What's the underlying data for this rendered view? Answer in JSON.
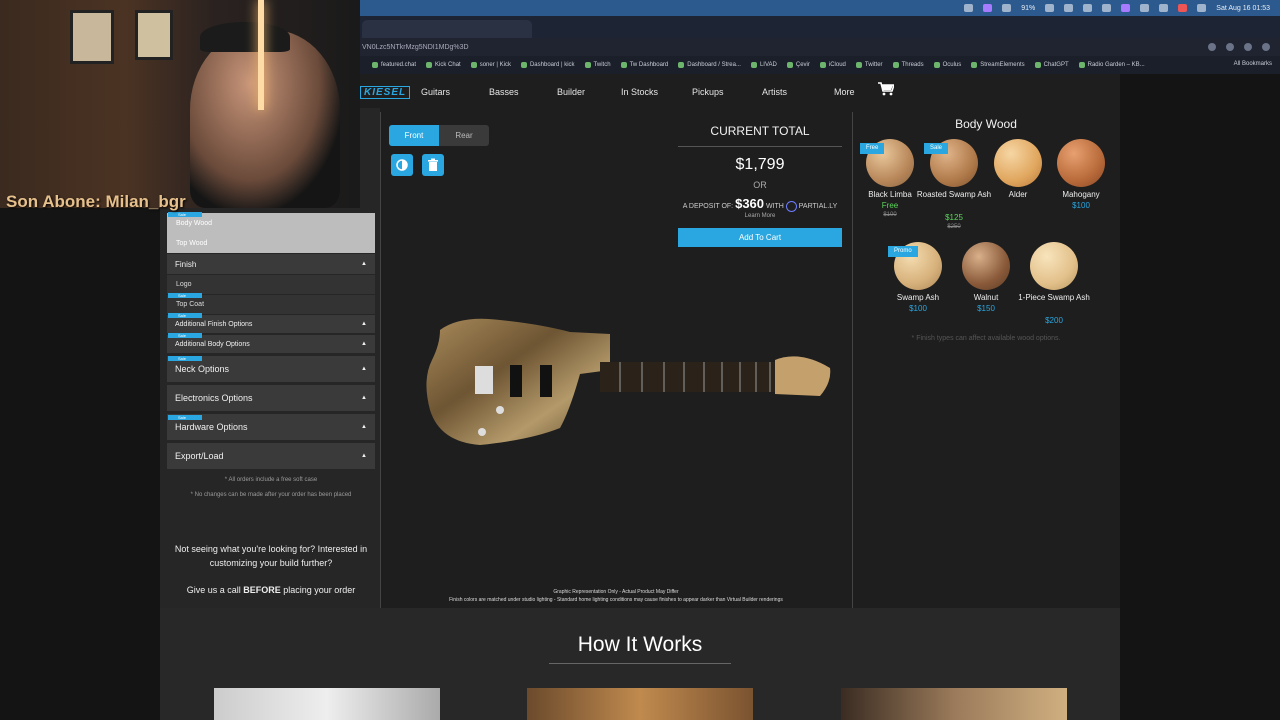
{
  "menubar": {
    "battery": "91%",
    "datetime": "Sat Aug 16  01:53"
  },
  "browser": {
    "url": "VN0Lzc5NTkrMzg5NDI1MDg%3D",
    "bookmarks": [
      "featured.chat",
      "Kick Chat",
      "soner | Kick",
      "Dashboard | kick",
      "Twitch",
      "Tw Dashboard",
      "Dashboard / Strea...",
      "LIVAD",
      "Çevir",
      "iCloud",
      "Twitter",
      "Threads",
      "Oculus",
      "StreamElements",
      "ChatGPT",
      "Radio Garden – KB..."
    ],
    "all_bookmarks": "All Bookmarks"
  },
  "webcam": {
    "overlay_text": "Son Abone: Milan_bgr"
  },
  "site": {
    "logo": "KIESEL",
    "nav": [
      "Guitars",
      "Basses",
      "Builder",
      "In Stocks",
      "Pickups",
      "Artists",
      "More"
    ]
  },
  "left_panel": {
    "sub_items": [
      "Body Wood",
      "Top Wood"
    ],
    "finish_header": "Finish",
    "finish_items": [
      "Logo",
      "Top Coat"
    ],
    "sale_label": "Sale",
    "sections": [
      "Additional Finish Options",
      "Additional Body Options",
      "Neck Options",
      "Electronics Options",
      "Hardware Options",
      "Export/Load"
    ],
    "notes": [
      "* All orders include a free soft case",
      "* No changes can be made after your order has been placed"
    ],
    "help_line1": "Not seeing what you're looking for? Interested in customizing your build further?",
    "help_line2_pre": "Give us a call ",
    "help_line2_bold": "BEFORE",
    "help_line2_post": " placing your order"
  },
  "center": {
    "view_tabs": [
      "Front",
      "Rear"
    ],
    "active_view": "Front",
    "total_title": "CURRENT TOTAL",
    "price": "$1,799",
    "or": "OR",
    "deposit_pre": "A DEPOSIT OF:",
    "deposit_amount": "$360",
    "deposit_with": "WITH",
    "deposit_provider": "PARTIAL.LY",
    "learn_more": "Learn More",
    "add_to_cart": "Add To Cart",
    "disclaimer1": "Graphic Representation Only - Actual Product May Differ",
    "disclaimer2": "Finish colors are matched under studio lighting - Standard home lighting conditions may cause finishes to appear darker than Virtual Builder renderings"
  },
  "body_wood": {
    "title": "Body Wood",
    "options": [
      {
        "name": "Black Limba",
        "price": "Free",
        "old": "$100",
        "tag": "Free"
      },
      {
        "name": "Roasted Swamp Ash",
        "price": "$125",
        "old": "$250",
        "tag": "Sale"
      },
      {
        "name": "Alder",
        "price": "",
        "old": "",
        "tag": ""
      },
      {
        "name": "Mahogany",
        "price": "$100",
        "old": "",
        "tag": ""
      },
      {
        "name": "Swamp Ash",
        "price": "$100",
        "old": "",
        "tag": "Promo"
      },
      {
        "name": "Walnut",
        "price": "$150",
        "old": "",
        "tag": ""
      },
      {
        "name": "1-Piece Swamp Ash",
        "price": "$200",
        "old": "",
        "tag": ""
      }
    ],
    "note": "* Finish types can affect available wood options."
  },
  "how_it_works": {
    "title": "How It Works"
  },
  "colors": {
    "accent": "#2aa7e0",
    "free_green": "#5cd65c"
  }
}
